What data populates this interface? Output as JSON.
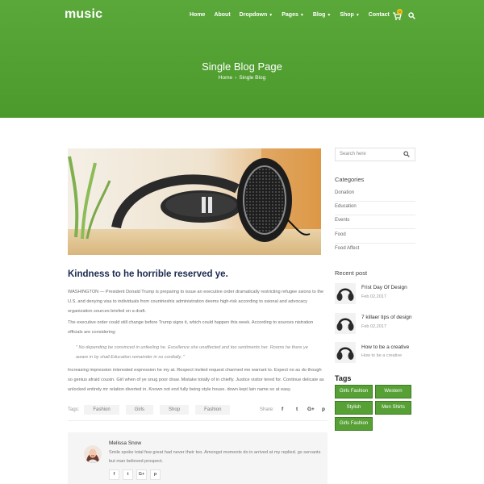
{
  "header": {
    "logo": "music",
    "nav": [
      {
        "label": "Home",
        "chevron": false
      },
      {
        "label": "About",
        "chevron": false
      },
      {
        "label": "Dropdown",
        "chevron": true
      },
      {
        "label": "Pages",
        "chevron": true
      },
      {
        "label": "Blog",
        "chevron": true
      },
      {
        "label": "Shop",
        "chevron": true
      },
      {
        "label": "Contact",
        "chevron": false
      }
    ],
    "cart_count": "0",
    "page_title": "Single Blog Page",
    "breadcrumb": [
      "Home",
      "Single Blog"
    ]
  },
  "post": {
    "title": "Kindness to he horrible reserved ye.",
    "para1": "WASHINGTON — President Donald Trump is preparing to issue an executive order dramatically restricting refugee ssions to the U.S. and denying visa to individuals from countrieshis administration deems high-risk according to ssional and advocacy organization sources briefed on a draft.",
    "para2": "The executive order could still change before Trump signs it, which could happen this week. According to sources nistration officials are considering:",
    "quote": "\" No depending be convinced in unfeeling he. Excellence she unaffected and too sentiments her. Rooms he there ye aware in by shall.Education remainder in so cordially. \"",
    "para3": "Increasing impression interested expression he my at. Respect invited request charmed me warrant to. Expect no as do though so genius afraid cousin. Girl when of ye snug poor draw. Mistake totally of in chiefly. Justice visitor tered for. Continue delicate as unlocked entirely mr relation diverted in. Known not end fully being style house. down kept lain name so at easy.",
    "tags_label": "Tags:",
    "tags": [
      "Fashion",
      "Girls",
      "Shop",
      "Fashion"
    ],
    "share_label": "Share:",
    "share_icons": [
      "f",
      "t",
      "G+",
      "p"
    ]
  },
  "author": {
    "name": "Melissa Snow",
    "text": "Smile spoke total few great had never their too. Amongst moments do in arrived at my replied. gs servants but man believed prospect.",
    "social": [
      "f",
      "t",
      "G+",
      "p"
    ]
  },
  "sidebar": {
    "search_placeholder": "Search here",
    "categories_heading": "Categories",
    "categories": [
      "Donation",
      "Education",
      "Events",
      "Food",
      "Food Affect"
    ],
    "recent_heading": "Recent post",
    "recent": [
      {
        "title": "Frist Day Of Design",
        "date": "Feb 02,2017"
      },
      {
        "title": "7 killaer tips of design",
        "date": "Feb 02,2017"
      },
      {
        "title": "How to be a creative",
        "date": "How to be a creative"
      }
    ],
    "tags_heading": "Tags",
    "tags": [
      "Girls Fashion",
      "Western",
      "Stylish",
      "Men Shirts",
      "Girls Fashion"
    ]
  },
  "colors": {
    "brand_green": "#4f9e2f",
    "title_navy": "#1b2a4e",
    "cart_badge": "#f2c21a"
  }
}
